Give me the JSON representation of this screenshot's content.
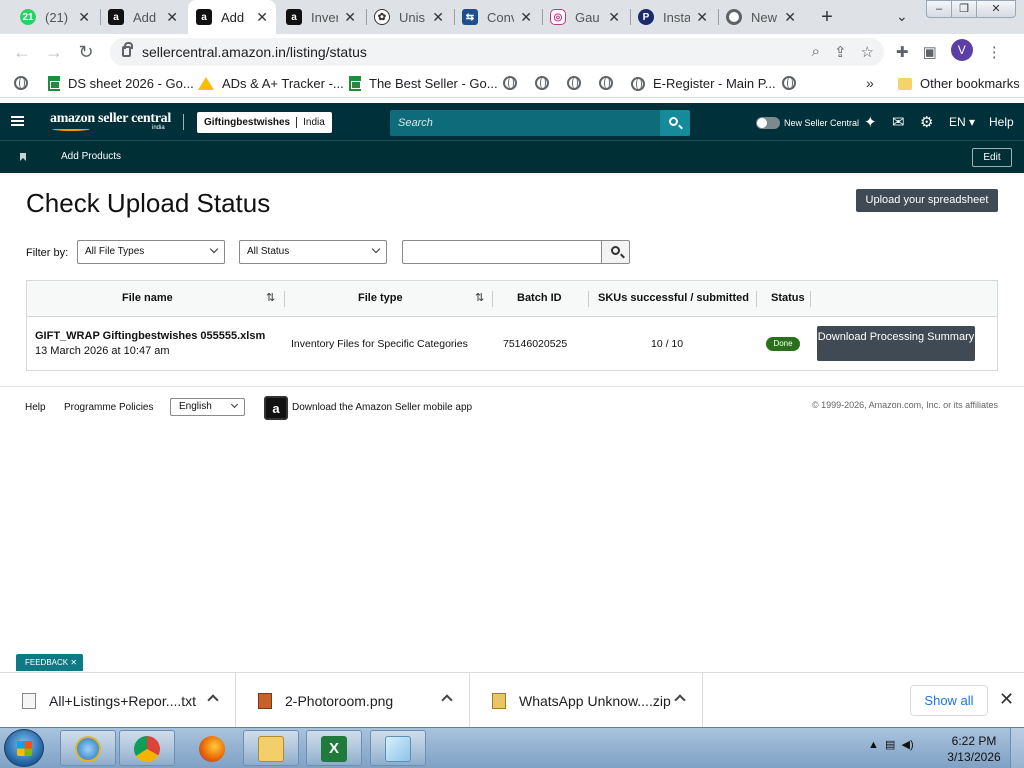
{
  "browser": {
    "tabs": [
      {
        "title": "(21)",
        "favicon": "whatsapp",
        "badge": "21",
        "active": false
      },
      {
        "title": "Add",
        "favicon": "amazon",
        "active": false
      },
      {
        "title": "Add",
        "favicon": "amazon",
        "active": true
      },
      {
        "title": "Inven",
        "favicon": "amazon",
        "active": false
      },
      {
        "title": "Unis",
        "favicon": "openai",
        "active": false
      },
      {
        "title": "Conv",
        "favicon": "converter",
        "active": false
      },
      {
        "title": "Gau",
        "favicon": "instagram",
        "active": false
      },
      {
        "title": "Insta",
        "favicon": "p-app",
        "active": false
      },
      {
        "title": "New",
        "favicon": "chrome",
        "active": false
      }
    ],
    "url": "sellercentral.amazon.in/listing/status",
    "profile_initial": "V",
    "bookmarks": [
      {
        "label": "",
        "icon": "globe"
      },
      {
        "label": "DS sheet 2026 - Go...",
        "icon": "sheets"
      },
      {
        "label": "ADs & A+ Tracker -...",
        "icon": "drive"
      },
      {
        "label": "The Best Seller - Go...",
        "icon": "sheets"
      },
      {
        "label": "",
        "icon": "globe"
      },
      {
        "label": "",
        "icon": "globe"
      },
      {
        "label": "",
        "icon": "globe"
      },
      {
        "label": "",
        "icon": "globe"
      },
      {
        "label": "E-Register - Main P...",
        "icon": "globe"
      },
      {
        "label": "",
        "icon": "globe"
      }
    ],
    "other_bookmarks": "Other bookmarks"
  },
  "seller_central": {
    "logo": "amazon seller central",
    "logo_region": "india",
    "account_name": "Giftingbestwishes",
    "marketplace": "India",
    "search_placeholder": "Search",
    "new_seller_central": "New Seller Central",
    "language": "EN",
    "help": "Help",
    "sub_nav_item": "Add Products",
    "edit": "Edit"
  },
  "page": {
    "title": "Check Upload Status",
    "upload_button": "Upload your spreadsheet",
    "filter_label": "Filter by:",
    "file_type_filter": "All File Types",
    "status_filter": "All Status",
    "search_value": "",
    "table": {
      "headers": [
        "File name",
        "File type",
        "Batch ID",
        "SKUs successful / submitted",
        "Status"
      ],
      "rows": [
        {
          "file_name": "GIFT_WRAP Giftingbestwishes 055555.xlsm",
          "uploaded": "13 March 2026 at 10:47 am",
          "file_type": "Inventory Files for Specific Categories",
          "batch_id": "75146020525",
          "skus": "10 / 10",
          "status": "Done",
          "action": "Download Processing Summary"
        }
      ]
    }
  },
  "footer": {
    "help": "Help",
    "programme_policies": "Programme Policies",
    "language": "English",
    "app_link": "Download the Amazon Seller mobile app",
    "copyright": "© 1999-2026, Amazon.com, Inc. or its affiliates"
  },
  "feedback": "FEEDBACK",
  "downloads": [
    {
      "name": "All+Listings+Repor....txt",
      "type": "txt"
    },
    {
      "name": "2-Photoroom.png",
      "type": "png"
    },
    {
      "name": "WhatsApp Unknow....zip",
      "type": "zip"
    }
  ],
  "downloads_show_all": "Show all",
  "taskbar": {
    "time": "6:22 PM",
    "date": "3/13/2026"
  },
  "colors": {
    "sc_nav": "#00313a",
    "sc_search": "#0e6b7a",
    "button_dark": "#3f4a55",
    "status_done": "#2a6f1b",
    "feedback": "#0e7a86"
  }
}
